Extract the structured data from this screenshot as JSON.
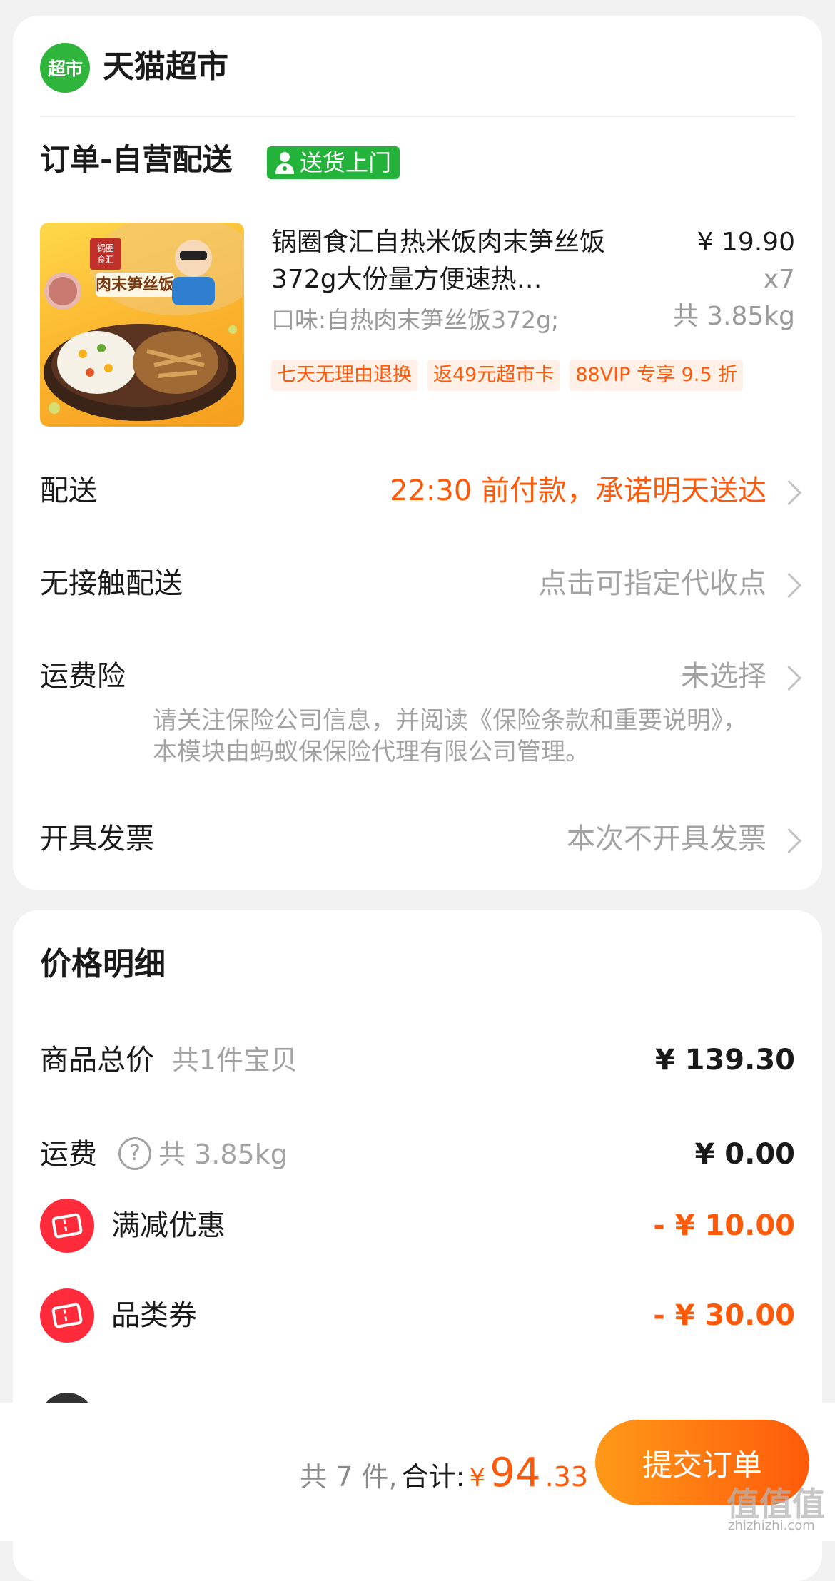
{
  "store": {
    "logo_text": "超市",
    "name": "天猫超市"
  },
  "order": {
    "title": "订单-自营配送",
    "delivery_tag": "送货上门",
    "product": {
      "title": "锅圈食汇自热米饭肉末笋丝饭372g大份量方便速热…",
      "spec": "口味:自热肉末笋丝饭372g;",
      "price": "¥ 19.90",
      "quantity": "x7",
      "weight": "共 3.85kg",
      "image_text": [
        "锅圈",
        "食汇",
        "肉末笋丝饭"
      ],
      "tags": [
        "七天无理由退换",
        "返49元超市卡",
        "88VIP 专享 9.5 折"
      ]
    },
    "rows": {
      "delivery": {
        "label": "配送",
        "value": "22:30 前付款，承诺明天送达"
      },
      "contactless": {
        "label": "无接触配送",
        "value": "点击可指定代收点"
      },
      "insurance": {
        "label": "运费险",
        "value": "未选择",
        "note": "请关注保险公司信息，并阅读《保险条款和重要说明》，本模块由蚂蚁保保险代理有限公司管理。"
      },
      "invoice": {
        "label": "开具发票",
        "value": "本次不开具发票"
      }
    }
  },
  "price_detail": {
    "title": "价格明细",
    "goods_total": {
      "label": "商品总价",
      "sub": "共1件宝贝",
      "value": "¥ 139.30"
    },
    "shipping": {
      "label": "运费",
      "help_icon": "?",
      "sub": "共 3.85kg",
      "value": "¥ 0.00"
    },
    "full_reduction": {
      "label": "满减优惠",
      "value": "- ¥ 10.00"
    },
    "category_coupon": {
      "label": "品类券",
      "value": "- ¥ 30.00"
    }
  },
  "bottom_bar": {
    "count": "共 7 件,",
    "total_label": "合计:",
    "currency": "¥",
    "total_int": "94",
    "total_dec": ".33",
    "submit_label": "提交订单"
  },
  "watermark": {
    "text": "值值值",
    "url": "zhizhizhi.com"
  },
  "colors": {
    "accent": "#ff5a0a",
    "tmall_green": "#2fb53c",
    "coupon_red": "#ff2a3a"
  }
}
